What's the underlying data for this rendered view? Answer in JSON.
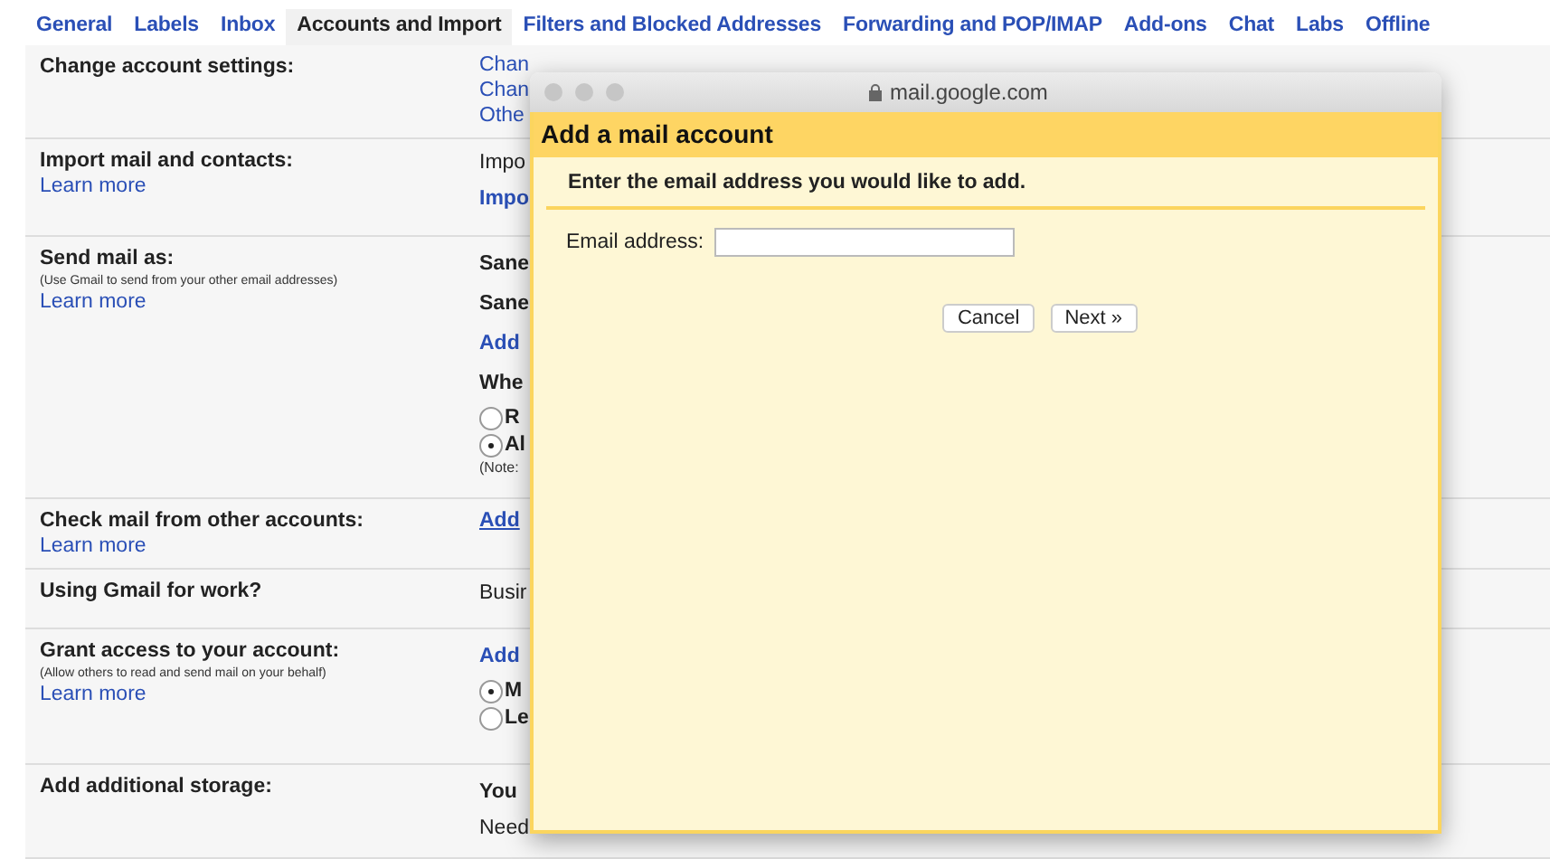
{
  "tabs": [
    {
      "label": "General",
      "selected": false
    },
    {
      "label": "Labels",
      "selected": false
    },
    {
      "label": "Inbox",
      "selected": false
    },
    {
      "label": "Accounts and Import",
      "selected": true
    },
    {
      "label": "Filters and Blocked Addresses",
      "selected": false
    },
    {
      "label": "Forwarding and POP/IMAP",
      "selected": false
    },
    {
      "label": "Add-ons",
      "selected": false
    },
    {
      "label": "Chat",
      "selected": false
    },
    {
      "label": "Labs",
      "selected": false
    },
    {
      "label": "Offline",
      "selected": false
    }
  ],
  "settings": [
    {
      "title": "Change account settings:",
      "lines": [
        {
          "kind": "link",
          "text": "Chan"
        },
        {
          "kind": "link",
          "text": "Chan"
        },
        {
          "kind": "link",
          "text": "Othe"
        }
      ]
    },
    {
      "title": "Import mail and contacts:",
      "learn_more": "Learn more",
      "lines": [
        {
          "kind": "text",
          "text": "Impo"
        },
        {
          "kind": "action",
          "text": "Impo"
        }
      ]
    },
    {
      "title": "Send mail as:",
      "note": "(Use Gmail to send from your other email addresses)",
      "learn_more": "Learn more",
      "lines": [
        {
          "kind": "bold",
          "text": "Sane"
        },
        {
          "kind": "bold",
          "text": "Sane"
        },
        {
          "kind": "action",
          "text": "Add"
        },
        {
          "kind": "bold",
          "text": "Whe"
        },
        {
          "kind": "radio",
          "text": "R",
          "selected": false
        },
        {
          "kind": "radio",
          "text": "Al",
          "selected": true
        },
        {
          "kind": "note",
          "text": "(Note: "
        }
      ]
    },
    {
      "title": "Check mail from other accounts:",
      "learn_more": "Learn more",
      "lines": [
        {
          "kind": "hover",
          "text": "Add"
        }
      ]
    },
    {
      "title": "Using Gmail for work?",
      "lines": [
        {
          "kind": "text",
          "text": "Busir"
        }
      ]
    },
    {
      "title": "Grant access to your account:",
      "note": "(Allow others to read and send mail on your behalf)",
      "learn_more": "Learn more",
      "lines": [
        {
          "kind": "action",
          "text": "Add"
        },
        {
          "kind": "radio",
          "text": "M",
          "selected": true
        },
        {
          "kind": "radio",
          "text": "Le",
          "selected": false
        }
      ]
    },
    {
      "title": "Add additional storage:",
      "lines": [
        {
          "kind": "bold",
          "text": "You"
        },
        {
          "kind": "text",
          "text": "Need"
        }
      ]
    }
  ],
  "popup": {
    "address_bar": "mail.google.com",
    "title": "Add a mail account",
    "prompt": "Enter the email address you would like to add.",
    "field_label": "Email address:",
    "buttons": [
      "Cancel",
      "Next »"
    ]
  }
}
